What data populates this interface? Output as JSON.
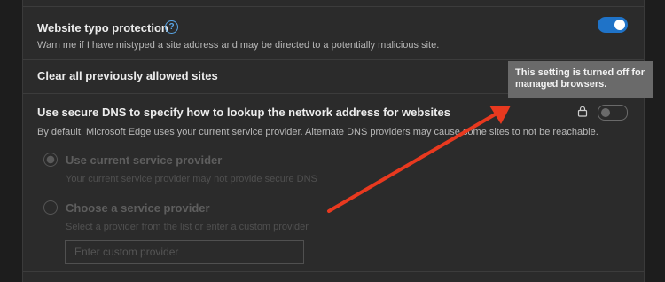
{
  "typo_protection": {
    "title": "Website typo protection",
    "help_glyph": "?",
    "description": "Warn me if I have mistyped a site address and may be directed to a potentially malicious site.",
    "toggle_state": "on",
    "clear_label": "Clear all previously allowed sites"
  },
  "secure_dns": {
    "title": "Use secure DNS to specify how to lookup the network address for websites",
    "description": "By default, Microsoft Edge uses your current service provider. Alternate DNS providers may cause some sites to not be reachable.",
    "toggle_state": "off",
    "lock_icon": "lock-icon",
    "options": [
      {
        "label": "Use current service provider",
        "description": "Your current service provider may not provide secure DNS",
        "selected": true
      },
      {
        "label": "Choose a service provider",
        "description": "Select a provider from the list or enter a custom provider",
        "selected": false
      }
    ],
    "custom_provider_placeholder": "Enter custom provider"
  },
  "tooltip": {
    "text": "This setting is turned off for managed browsers."
  },
  "colors": {
    "accent": "#1f73c8",
    "annotation_arrow": "#e8391f",
    "tooltip_bg": "#6a6a6a"
  }
}
